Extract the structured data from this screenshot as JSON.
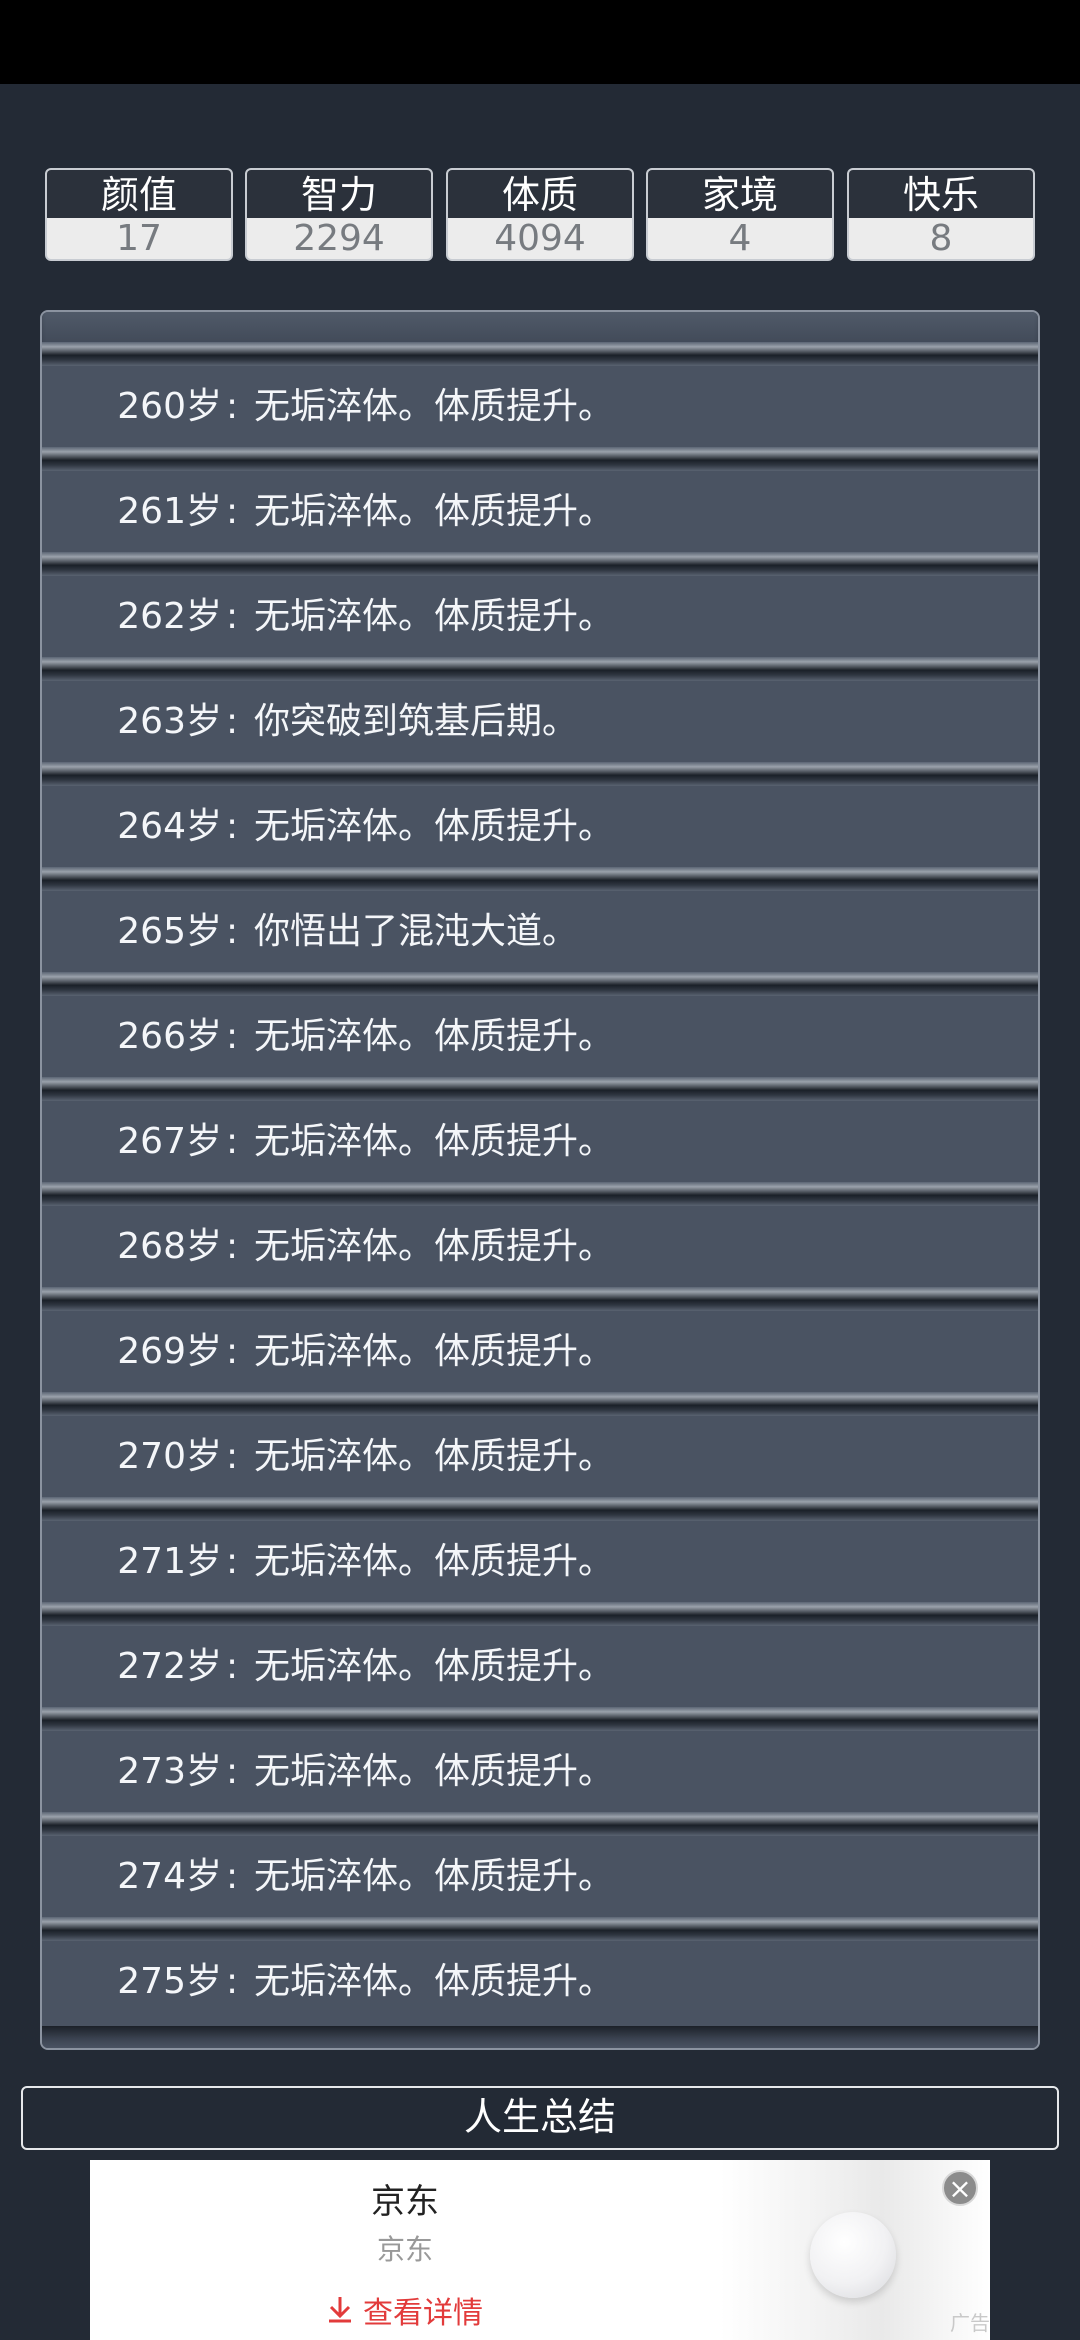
{
  "stats": [
    {
      "label": "颜值",
      "value": "17"
    },
    {
      "label": "智力",
      "value": "2294"
    },
    {
      "label": "体质",
      "value": "4094"
    },
    {
      "label": "家境",
      "value": "4"
    },
    {
      "label": "快乐",
      "value": "8"
    }
  ],
  "log": [
    {
      "age": "260岁",
      "sep": ":",
      "event": "无垢淬体。体质提升。"
    },
    {
      "age": "261岁",
      "sep": ":",
      "event": "无垢淬体。体质提升。"
    },
    {
      "age": "262岁",
      "sep": ":",
      "event": "无垢淬体。体质提升。"
    },
    {
      "age": "263岁",
      "sep": ":",
      "event": "你突破到筑基后期。"
    },
    {
      "age": "264岁",
      "sep": ":",
      "event": "无垢淬体。体质提升。"
    },
    {
      "age": "265岁",
      "sep": ":",
      "event": "你悟出了混沌大道。"
    },
    {
      "age": "266岁",
      "sep": ":",
      "event": "无垢淬体。体质提升。"
    },
    {
      "age": "267岁",
      "sep": ":",
      "event": "无垢淬体。体质提升。"
    },
    {
      "age": "268岁",
      "sep": ":",
      "event": "无垢淬体。体质提升。"
    },
    {
      "age": "269岁",
      "sep": ":",
      "event": "无垢淬体。体质提升。"
    },
    {
      "age": "270岁",
      "sep": ":",
      "event": "无垢淬体。体质提升。"
    },
    {
      "age": "271岁",
      "sep": ":",
      "event": "无垢淬体。体质提升。"
    },
    {
      "age": "272岁",
      "sep": ":",
      "event": "无垢淬体。体质提升。"
    },
    {
      "age": "273岁",
      "sep": ":",
      "event": "无垢淬体。体质提升。"
    },
    {
      "age": "274岁",
      "sep": ":",
      "event": "无垢淬体。体质提升。"
    },
    {
      "age": "275岁",
      "sep": ":",
      "event": "无垢淬体。体质提升。"
    }
  ],
  "summary_button": "人生总结",
  "ad": {
    "title": "京东",
    "subtitle": "京东",
    "cta": "查看详情",
    "tag": "广告",
    "icons": {
      "download": "download-icon",
      "close": "close-icon"
    },
    "colors": {
      "cta": "#e23b3b"
    }
  },
  "colors": {
    "background": "#232a35",
    "row": "#4a5362",
    "stat_value_bg": "#ececec"
  }
}
